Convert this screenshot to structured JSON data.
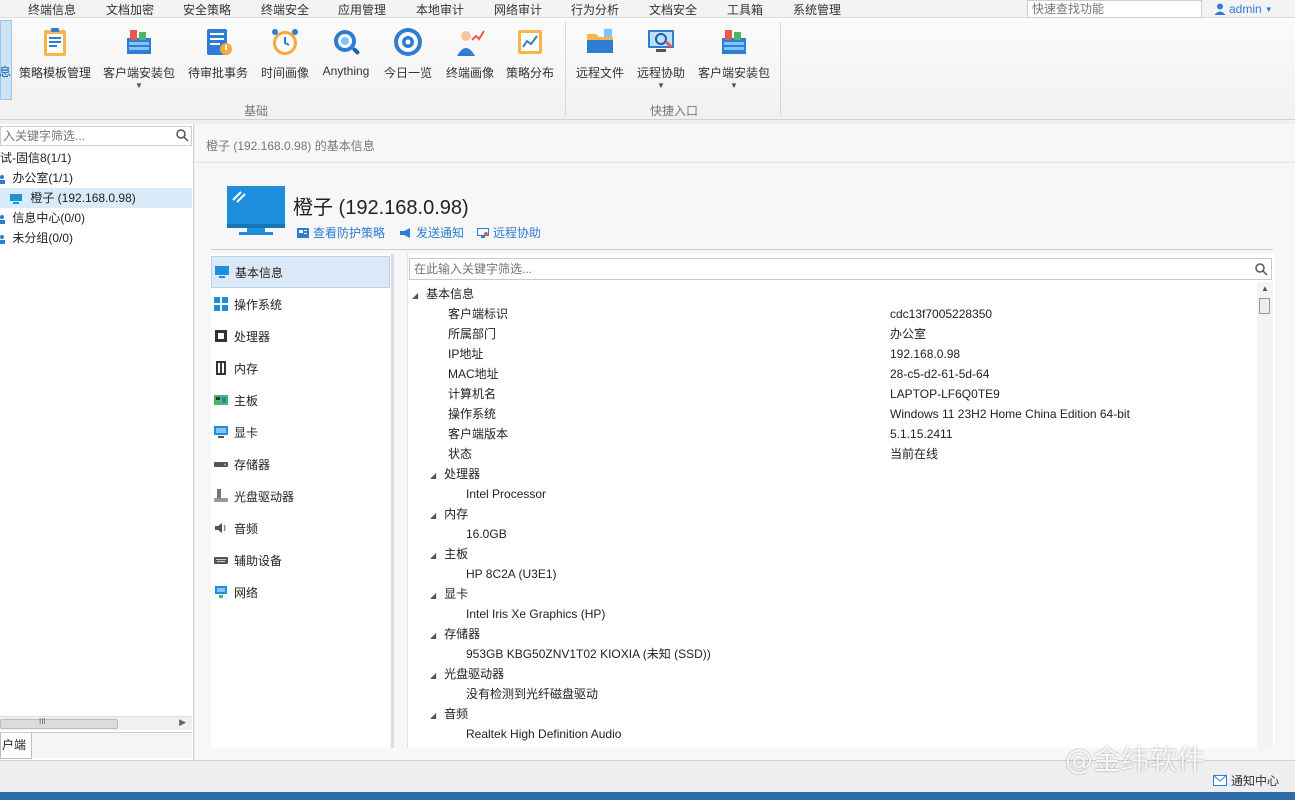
{
  "menu": {
    "items": [
      "终端信息",
      "文档加密",
      "安全策略",
      "终端安全",
      "应用管理",
      "本地审计",
      "网络审计",
      "行为分析",
      "文档安全",
      "工具箱",
      "系统管理"
    ],
    "search_placeholder": "快速查找功能",
    "user": "admin"
  },
  "ribbon": {
    "left_stub": "息",
    "group1": {
      "label": "基础",
      "buttons": [
        "策略模板管理",
        "客户端安装包",
        "待审批事务",
        "时间画像",
        "Anything",
        "今日一览",
        "终端画像",
        "策略分布"
      ]
    },
    "group2": {
      "label": "快捷入口",
      "buttons": [
        "远程文件",
        "远程协助",
        "客户端安装包"
      ]
    }
  },
  "left_panel": {
    "search_placeholder": "入关键字筛选...",
    "tree": [
      {
        "label": "试-固信8(1/1)"
      },
      {
        "label": "办公室(1/1)"
      },
      {
        "label": "橙子 (192.168.0.98)"
      },
      {
        "label": "信息中心(0/0)"
      },
      {
        "label": "未分组(0/0)"
      }
    ],
    "scroll_grip": "III",
    "tab_label": "户端"
  },
  "main": {
    "breadcrumb": "橙子 (192.168.0.98) 的基本信息",
    "device_title": "橙子 (192.168.0.98)",
    "actions": [
      "查看防护策略",
      "发送通知",
      "远程协助"
    ],
    "categories": [
      "基本信息",
      "操作系统",
      "处理器",
      "内存",
      "主板",
      "显卡",
      "存储器",
      "光盘驱动器",
      "音频",
      "辅助设备",
      "网络"
    ],
    "detail_search_placeholder": "在此输入关键字筛选...",
    "basic_header": "基本信息",
    "basic_rows": [
      {
        "label": "客户端标识",
        "value": "cdc13f7005228350"
      },
      {
        "label": "所属部门",
        "value": "办公室"
      },
      {
        "label": "IP地址",
        "value": "192.168.0.98"
      },
      {
        "label": "MAC地址",
        "value": "28-c5-d2-61-5d-64"
      },
      {
        "label": "计算机名",
        "value": "LAPTOP-LF6Q0TE9"
      },
      {
        "label": "操作系统",
        "value": "Windows 11 23H2 Home China Edition 64-bit"
      },
      {
        "label": "客户端版本",
        "value": "5.1.15.2411"
      },
      {
        "label": "状态",
        "value": "当前在线"
      }
    ],
    "sections": [
      {
        "title": "处理器",
        "value": "Intel Processor"
      },
      {
        "title": "内存",
        "value": "16.0GB"
      },
      {
        "title": "主板",
        "value": "HP 8C2A (U3E1)"
      },
      {
        "title": "显卡",
        "value": "Intel Iris Xe Graphics (HP)"
      },
      {
        "title": "存储器",
        "value": "953GB KBG50ZNV1T02 KIOXIA (未知 (SSD))"
      },
      {
        "title": "光盘驱动器",
        "value": "没有检测到光纤磁盘驱动"
      },
      {
        "title": "音频",
        "value": "Realtek High Definition Audio"
      }
    ]
  },
  "statusbar": {
    "notify": "通知中心"
  },
  "watermark": "@金纬软件",
  "colors": {
    "accent": "#2d7dd2",
    "selected": "#d9eaf9",
    "monitor": "#1e8fdc"
  }
}
